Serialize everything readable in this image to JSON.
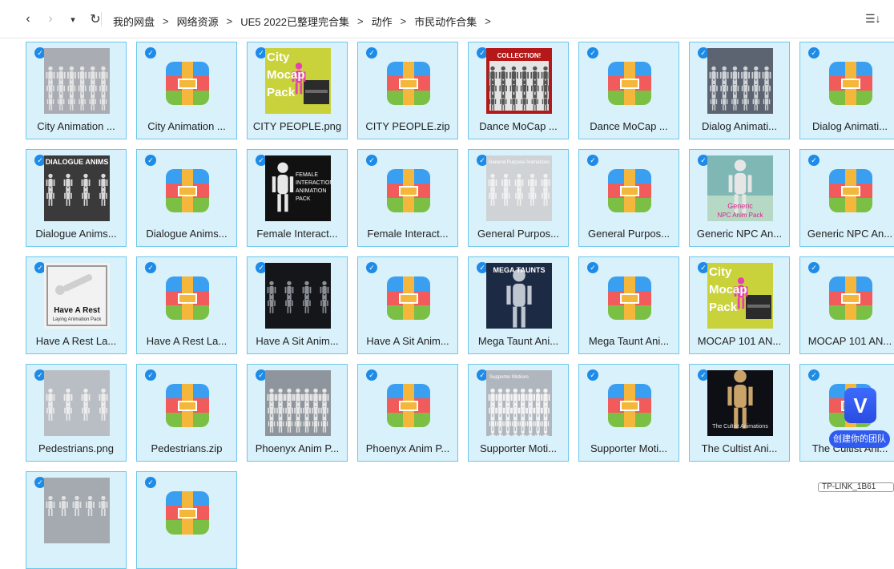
{
  "nav": {
    "back": "‹",
    "forward": "›",
    "dropdown": "▾",
    "refresh": "↻"
  },
  "breadcrumb": [
    "我的网盘",
    "网络资源",
    "UE5 2022已整理完合集",
    "动作",
    "市民动作合集"
  ],
  "breadcrumb_sep": ">",
  "toolbar": {
    "sort": "☰↓",
    "more": "⋮"
  },
  "files": [
    {
      "name": "City Animation ...",
      "type": "image"
    },
    {
      "name": "City Animation ...",
      "type": "zip"
    },
    {
      "name": "CITY PEOPLE.png",
      "type": "image"
    },
    {
      "name": "CITY PEOPLE.zip",
      "type": "zip"
    },
    {
      "name": "Dance MoCap ...",
      "type": "image"
    },
    {
      "name": "Dance MoCap ...",
      "type": "zip"
    },
    {
      "name": "Dialog Animati...",
      "type": "image"
    },
    {
      "name": "Dialog Animati...",
      "type": "zip"
    },
    {
      "name": "Dialogue Anims...",
      "type": "image"
    },
    {
      "name": "Dialogue Anims...",
      "type": "zip"
    },
    {
      "name": "Female Interact...",
      "type": "image"
    },
    {
      "name": "Female Interact...",
      "type": "zip"
    },
    {
      "name": "General Purpos...",
      "type": "image"
    },
    {
      "name": "General Purpos...",
      "type": "zip"
    },
    {
      "name": "Generic NPC An...",
      "type": "image"
    },
    {
      "name": "Generic NPC An...",
      "type": "zip"
    },
    {
      "name": "Have A Rest La...",
      "type": "image"
    },
    {
      "name": "Have A Rest La...",
      "type": "zip"
    },
    {
      "name": "Have A Sit Anim...",
      "type": "image"
    },
    {
      "name": "Have A Sit Anim...",
      "type": "zip"
    },
    {
      "name": "Mega Taunt Ani...",
      "type": "image"
    },
    {
      "name": "Mega Taunt Ani...",
      "type": "zip"
    },
    {
      "name": "MOCAP 101 AN...",
      "type": "image"
    },
    {
      "name": "MOCAP 101 AN...",
      "type": "zip"
    },
    {
      "name": "Pedestrians.png",
      "type": "image"
    },
    {
      "name": "Pedestrians.zip",
      "type": "zip"
    },
    {
      "name": "Phoenyx Anim P...",
      "type": "image"
    },
    {
      "name": "Phoenyx Anim P...",
      "type": "zip"
    },
    {
      "name": "Supporter Moti...",
      "type": "image"
    },
    {
      "name": "Supporter Moti...",
      "type": "zip"
    },
    {
      "name": "The Cultist Ani...",
      "type": "image"
    },
    {
      "name": "The Cultist Ani...",
      "type": "zip"
    },
    {
      "name": "",
      "type": "image"
    },
    {
      "name": "",
      "type": "zip"
    }
  ],
  "thumb_text": {
    "city_mocap": "City Mocap Pack",
    "collection": "COLLECTION!",
    "dialogue_anims": "DIALOGUE ANIMS",
    "female_pack": "FEMALE INTERACTION ANIMATION PACK",
    "general_purpose": "General Purpose Animations",
    "generic_npc": "Generic NPC Anim Pack",
    "have_a_rest": "Have A Rest",
    "laying_pack": "Laying Animation Pack",
    "mega_taunts": "The MEGA TAUNTS Collection",
    "supporter": "Supporter Motions",
    "cultist": "The Cultist Animations"
  },
  "badge": {
    "logo": "V",
    "text": "创建你的团队"
  },
  "router": "TP-LINK_1B61"
}
